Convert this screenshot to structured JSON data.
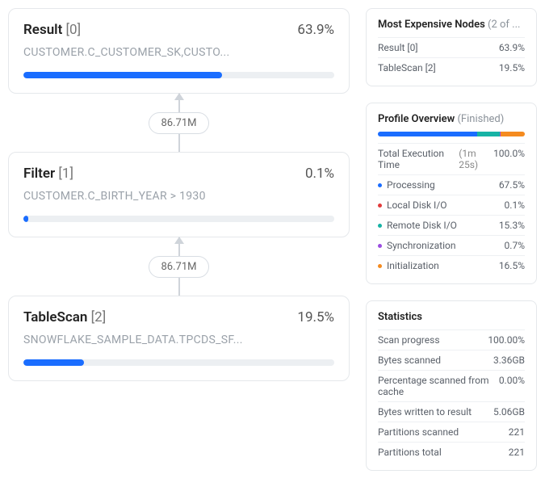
{
  "nodes": [
    {
      "title": "Result",
      "index": "[0]",
      "pct": "63.9%",
      "subtitle": "CUSTOMER.C_CUSTOMER_SK,CUSTO...",
      "bar_width": "63.9%"
    },
    {
      "title": "Filter",
      "index": "[1]",
      "pct": "0.1%",
      "subtitle": "CUSTOMER.C_BIRTH_YEAR > 1930",
      "bar_width": "1.5%"
    },
    {
      "title": "TableScan",
      "index": "[2]",
      "pct": "19.5%",
      "subtitle": "SNOWFLAKE_SAMPLE_DATA.TPCDS_SF...",
      "bar_width": "19.5%"
    }
  ],
  "edges": [
    {
      "label": "86.71M"
    },
    {
      "label": "86.71M"
    }
  ],
  "expensive": {
    "title": "Most Expensive Nodes",
    "subtitle": "(2 of ...",
    "rows": [
      {
        "k": "Result [0]",
        "v": "63.9%"
      },
      {
        "k": "TableScan [2]",
        "v": "19.5%"
      }
    ]
  },
  "overview": {
    "title": "Profile Overview",
    "subtitle": "(Finished)",
    "total_label": "Total Execution Time",
    "total_time": "(1m 25s)",
    "total_pct": "100.0%",
    "segments": [
      {
        "label": "Processing",
        "pct": "67.5%",
        "color": "#1a6dff"
      },
      {
        "label": "Local Disk I/O",
        "pct": "0.1%",
        "color": "#e23b3b"
      },
      {
        "label": "Remote Disk I/O",
        "pct": "15.3%",
        "color": "#17b3a5"
      },
      {
        "label": "Synchronization",
        "pct": "0.7%",
        "color": "#9b4de0"
      },
      {
        "label": "Initialization",
        "pct": "16.5%",
        "color": "#f58b1f"
      }
    ]
  },
  "stats": {
    "title": "Statistics",
    "rows": [
      {
        "k": "Scan progress",
        "v": "100.00%"
      },
      {
        "k": "Bytes scanned",
        "v": "3.36GB"
      },
      {
        "k": "Percentage scanned from cache",
        "v": "0.00%"
      },
      {
        "k": "Bytes written to result",
        "v": "5.06GB"
      },
      {
        "k": "Partitions scanned",
        "v": "221"
      },
      {
        "k": "Partitions total",
        "v": "221"
      }
    ]
  }
}
